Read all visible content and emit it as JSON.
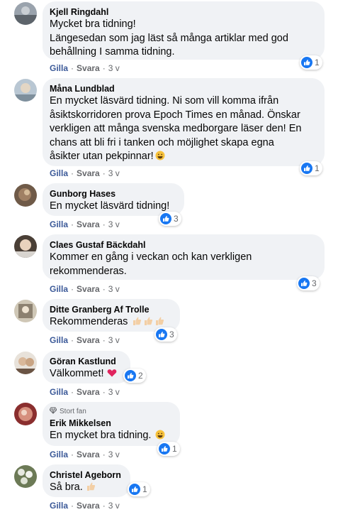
{
  "actions": {
    "like": "Gilla",
    "reply": "Svara",
    "separator": "·"
  },
  "comments": [
    {
      "author": "Kjell Ringdahl",
      "lines": [
        "Mycket bra tidning!",
        "Längesedan som jag läst så många artiklar med god",
        "behållning I samma tidning."
      ],
      "time": "3 v",
      "reactions": "1"
    },
    {
      "author": "Måna Lundblad",
      "lines": [
        "En mycket läsvärd tidning. Ni som vill komma ifrån",
        "åsiktskorridoren prova Epoch Times en månad. Önskar",
        "verkligen att många svenska medborgare läser den! En",
        "chans att bli fri i tanken och möjlighet skapa egna",
        "åsikter utan pekpinnar!"
      ],
      "trailing_emoji": "grinning-face",
      "time": "3 v",
      "reactions": "1"
    },
    {
      "author": "Gunborg Hases",
      "lines": [
        "En mycket läsvärd tidning!"
      ],
      "time": "3 v",
      "reactions": "3"
    },
    {
      "author": "Claes Gustaf Bäckdahl",
      "lines": [
        "Kommer en gång i veckan och kan verkligen",
        "rekommenderas."
      ],
      "time": "3 v",
      "reactions": "3"
    },
    {
      "author": "Ditte Granberg Af Trolle",
      "lines": [
        "Rekommenderas"
      ],
      "trailing_emoji": "thumbs-up x3",
      "time": "3 v",
      "reactions": "3"
    },
    {
      "author": "Göran Kastlund",
      "lines": [
        "Välkommet!"
      ],
      "trailing_emoji": "red-heart",
      "time": "3 v",
      "reactions": "2"
    },
    {
      "badge": "Stort fan",
      "author": "Erik Mikkelsen",
      "lines": [
        "En mycket bra tidning."
      ],
      "trailing_emoji": "grinning-face",
      "time": "3 v",
      "reactions": "1"
    },
    {
      "author": "Christel Ageborn",
      "lines": [
        "Så bra."
      ],
      "trailing_emoji": "thumbs-up",
      "time": "3 v",
      "reactions": "1"
    }
  ],
  "colors": {
    "bubble": "#f0f2f5",
    "like_link": "#3b5998",
    "muted": "#65676b",
    "like_blue": "#1877f2"
  }
}
